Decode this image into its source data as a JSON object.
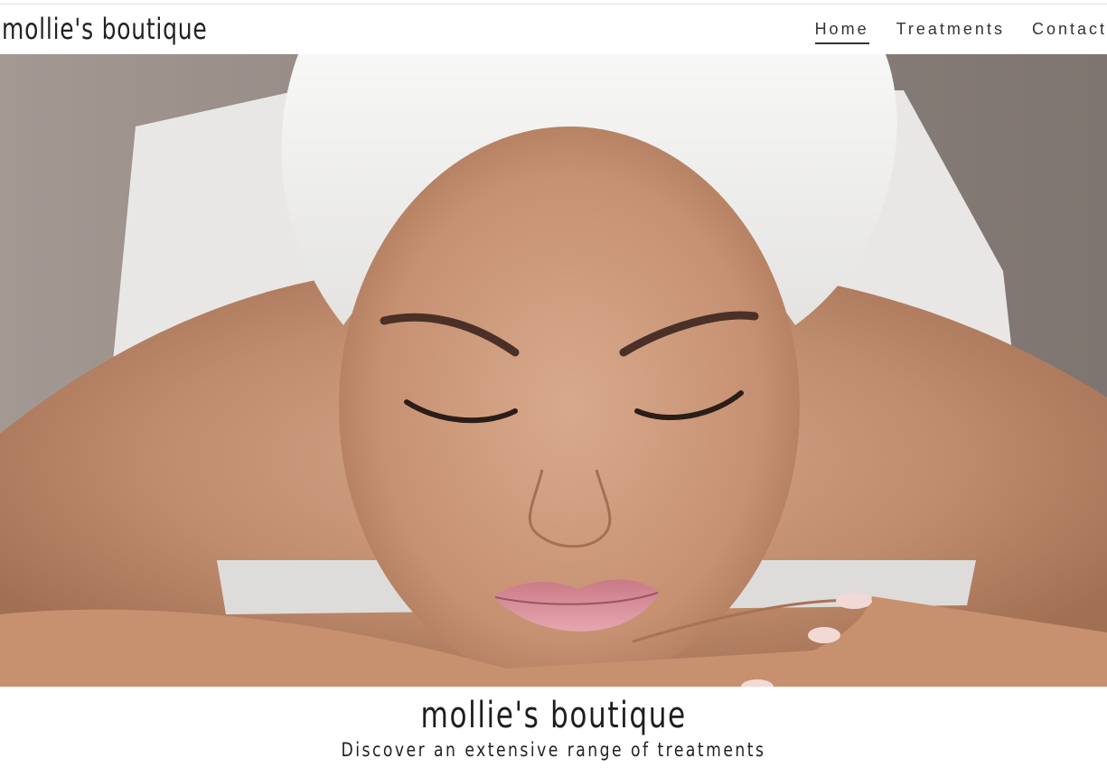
{
  "header": {
    "site_title": "mollie's boutique",
    "nav": [
      {
        "label": "Home",
        "active": true
      },
      {
        "label": "Treatments",
        "active": false
      },
      {
        "label": "Contact",
        "active": false
      }
    ]
  },
  "hero": {
    "image": "spa-woman-with-towel-photo"
  },
  "caption": {
    "title": "mollie's boutique",
    "subtitle": "Discover an extensive range of treatments"
  }
}
